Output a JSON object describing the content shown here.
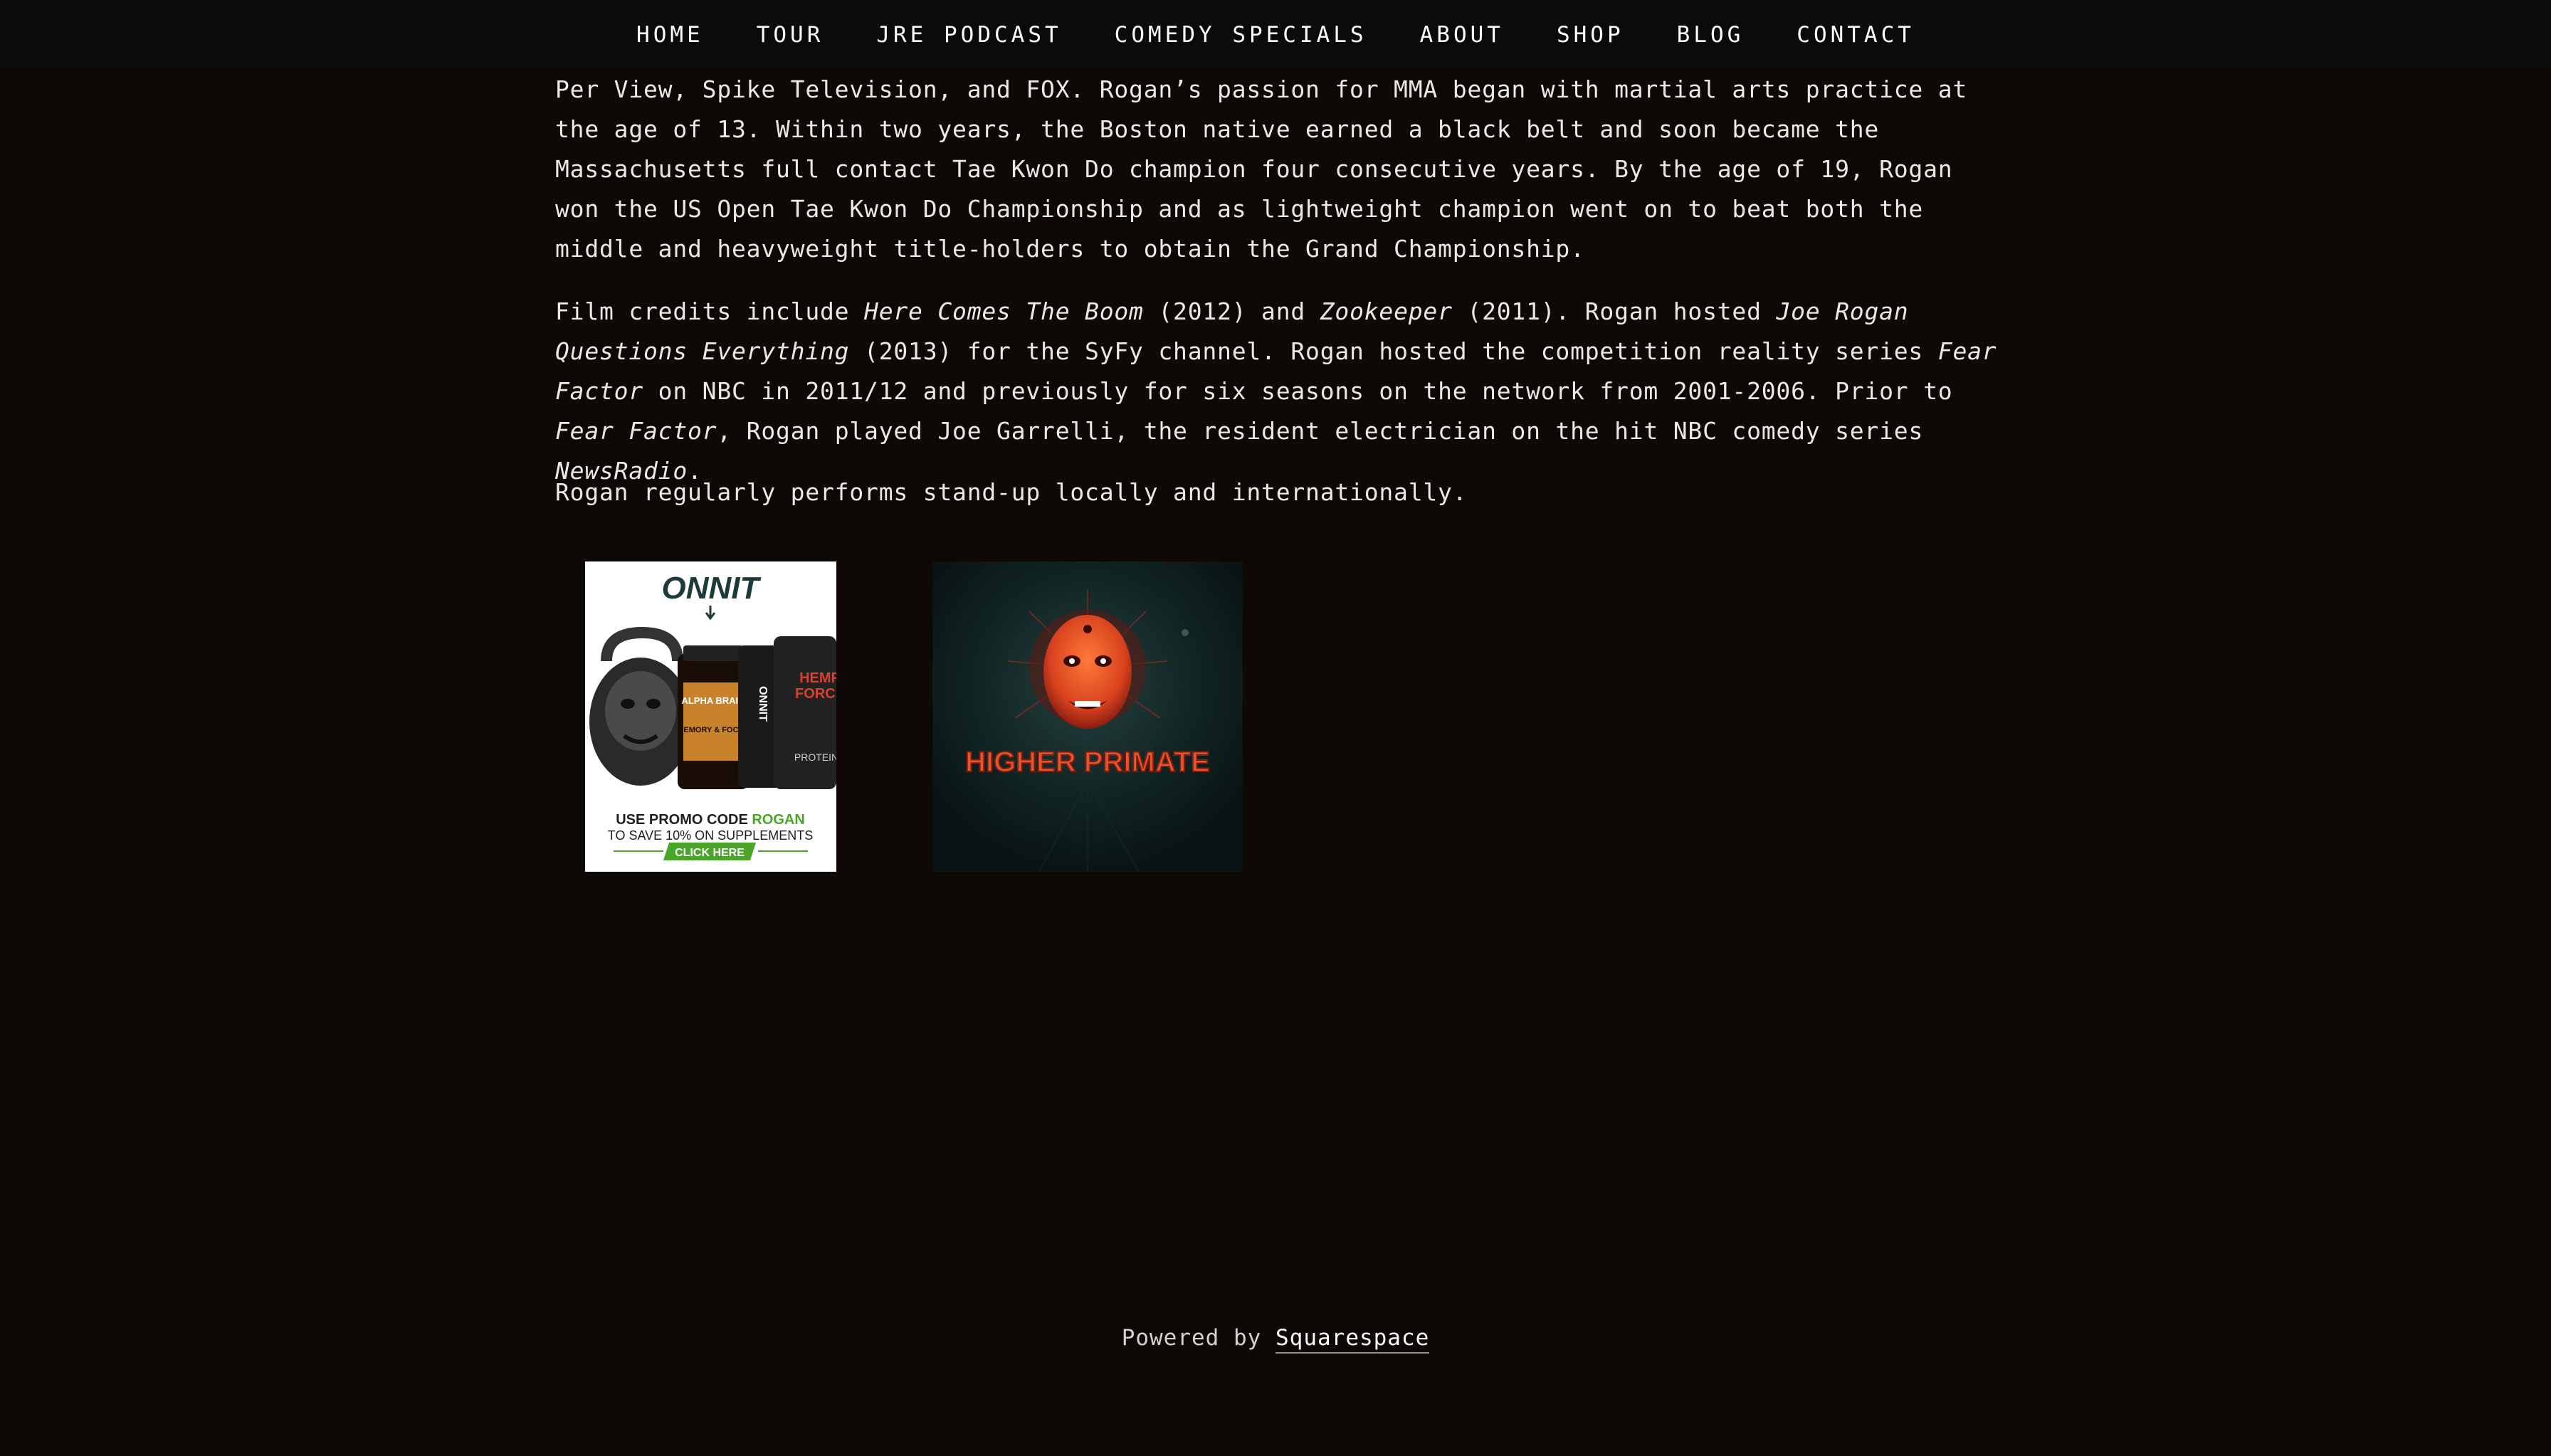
{
  "nav": {
    "items": [
      "HOME",
      "TOUR",
      "JRE PODCAST",
      "COMEDY SPECIALS",
      "ABOUT",
      "SHOP",
      "BLOG",
      "CONTACT"
    ]
  },
  "bio": {
    "p1": "Per View, Spike Television, and FOX.  Rogan’s passion for MMA began with martial arts practice at the age of 13. Within two years, the Boston native earned a black belt and soon became the Massachusetts full contact Tae Kwon Do champion four consecutive years.  By the age of 19, Rogan won the US Open Tae Kwon Do Championship and as lightweight champion went on to beat both the middle and heavyweight title-holders to obtain the Grand Championship.",
    "p2_a": "Film credits include ",
    "p2_b": "Here Comes The Boom",
    "p2_c": " (2012) and ",
    "p2_d": "Zookeeper",
    "p2_e": " (2011).  Rogan  hosted ",
    "p2_f": "Joe Rogan Questions Everything",
    "p2_g": " (2013) for the SyFy channel.  Rogan hosted the competition reality series ",
    "p2_h": "Fear Factor",
    "p2_i": " on NBC in 2011/12 and previously for six seasons on the network from 2001-2006.  Prior to ",
    "p2_j": "Fear Factor",
    "p2_k": ", Rogan played Joe Garrelli, the resident electrician on the hit NBC comedy series ",
    "p2_l": "NewsRadio",
    "p2_m": ".",
    "p3": "Rogan regularly performs stand-up locally and internationally."
  },
  "ads": {
    "onnit": {
      "brand": "ONNIT",
      "jar_label": "ALPHA BRAIN",
      "jar_sub": "MEMORY & FOCUS",
      "jar2": "ONNIT",
      "jar3_a": "HEMP",
      "jar3_b": "FORCE",
      "jar3_c": "PROTEIN",
      "promo_a": "USE PROMO CODE ",
      "promo_code": "ROGAN",
      "promo_b": "TO SAVE 10% ON SUPPLEMENTS",
      "cta": "CLICK HERE"
    },
    "higher_primate": {
      "title": "HIGHER PRIMATE"
    }
  },
  "footer": {
    "powered": "Powered by ",
    "link": "Squarespace"
  },
  "colors": {
    "background": "#0e0807",
    "nav_bg": "#0c0b0b",
    "onnit_green": "#4aa628",
    "higher_primate_orange": "#e8542c"
  }
}
